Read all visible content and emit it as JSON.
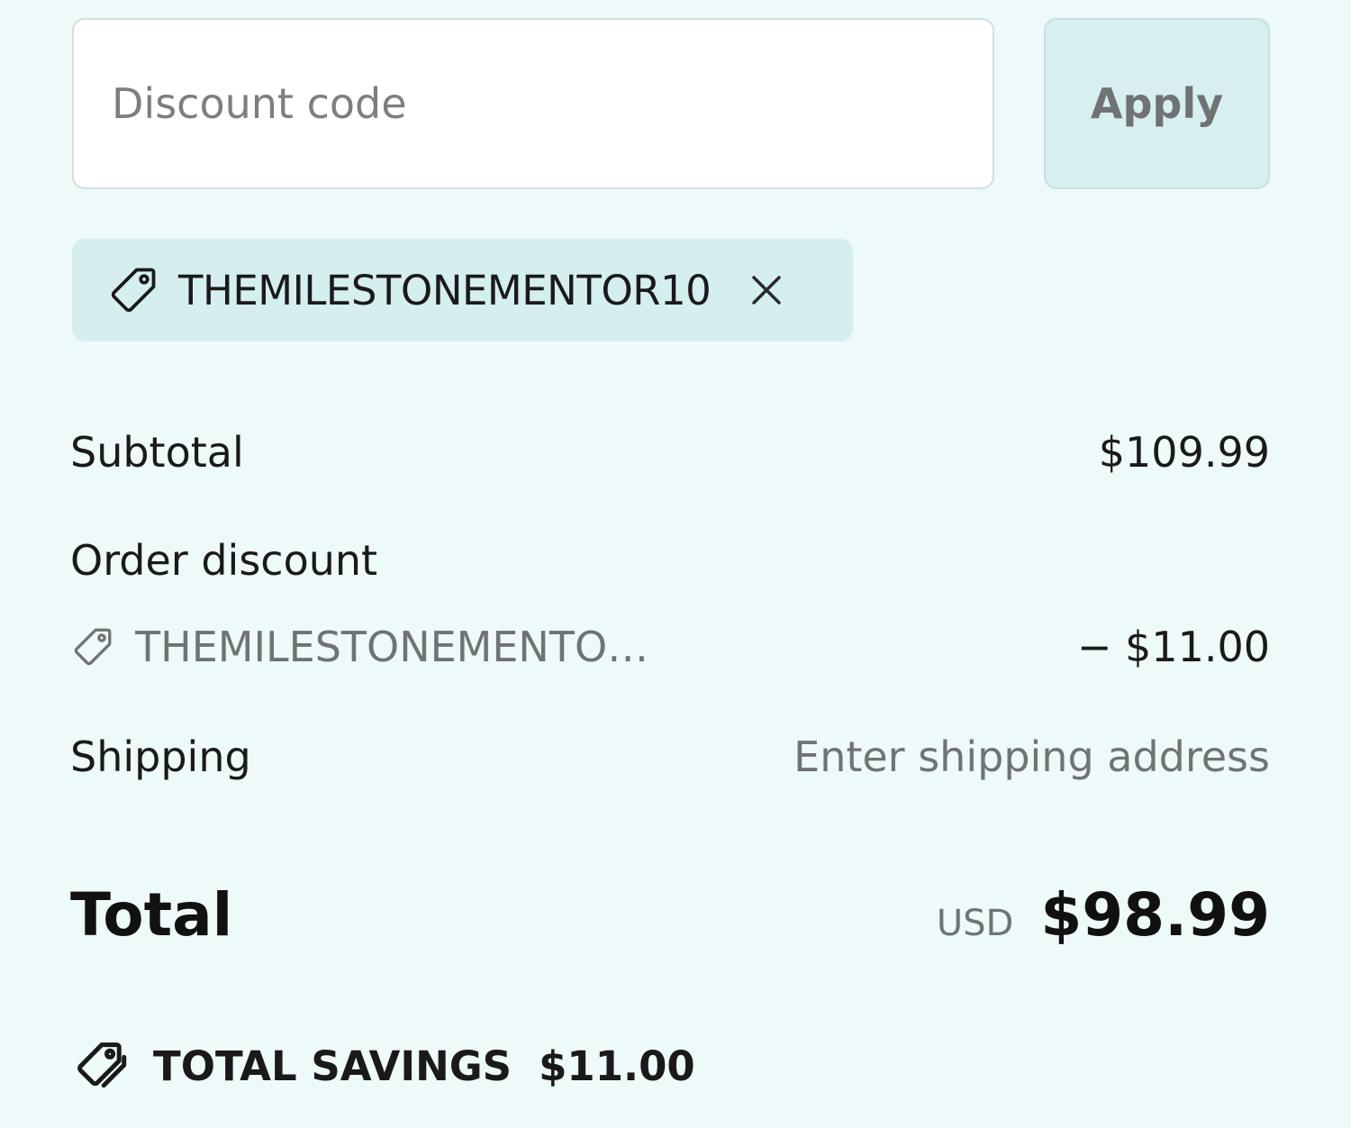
{
  "discount_form": {
    "input_placeholder": "Discount code",
    "input_value": "",
    "apply_label": "Apply"
  },
  "applied_code": {
    "code": "THEMILESTONEMENTOR10",
    "tag_icon": "tag-icon",
    "remove_icon": "close-icon"
  },
  "summary": {
    "subtotal_label": "Subtotal",
    "subtotal_value": "$109.99",
    "order_discount_label": "Order discount",
    "order_discount_code": "THEMILESTONEMENTOR10",
    "order_discount_value": "− $11.00",
    "shipping_label": "Shipping",
    "shipping_value": "Enter shipping address",
    "total_label": "Total",
    "total_currency": "USD",
    "total_value": "$98.99"
  },
  "savings": {
    "icon": "savings-tag-icon",
    "label": "TOTAL SAVINGS",
    "value": "$11.00"
  },
  "colors": {
    "background": "#eef9f9",
    "chip_background": "#d5eef0",
    "apply_background": "#d8eff1",
    "muted_text": "#6f7374"
  }
}
